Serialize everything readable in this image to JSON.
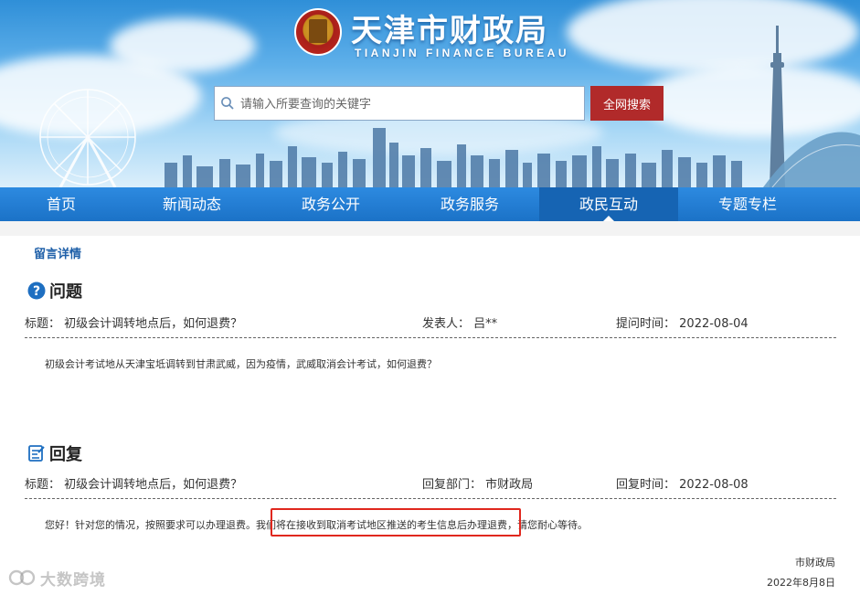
{
  "header": {
    "title_cn": "天津市财政局",
    "title_en": "TIANJIN FINANCE BUREAU",
    "search": {
      "placeholder": "请输入所要查询的关键字",
      "button_label": "全网搜索"
    }
  },
  "nav": {
    "items": [
      {
        "label": "首页"
      },
      {
        "label": "新闻动态"
      },
      {
        "label": "政务公开"
      },
      {
        "label": "政务服务"
      },
      {
        "label": "政民互动",
        "active": true
      },
      {
        "label": "专题专栏"
      }
    ]
  },
  "breadcrumb": "留言详情",
  "question": {
    "heading": "问题",
    "title_label": "标题：",
    "title": "初级会计调转地点后，如何退费？",
    "poster_label": "发表人：",
    "poster": "吕**",
    "time_label": "提问时间：",
    "time": "2022-08-04",
    "content": "初级会计考试地从天津宝坻调转到甘肃武威，因为疫情，武威取消会计考试，如何退费？"
  },
  "reply": {
    "heading": "回复",
    "title_label": "标题：",
    "title": "初级会计调转地点后，如何退费？",
    "dept_label": "回复部门：",
    "dept": "市财政局",
    "time_label": "回复时间：",
    "time": "2022-08-08",
    "content_pre": "您好！针对您的情况，按照要求可以办理退费。我们将在接收到取消考试地区推送的考生信息后办理退费，请您耐心等待。",
    "signature_org": "市财政局",
    "signature_date": "2022年8月8日"
  },
  "watermark": "大数跨境",
  "colors": {
    "nav": "#1f7bd0",
    "search_button": "#b12a2a",
    "highlight": "#e0271e",
    "breadcrumb": "#1e5fa8"
  }
}
